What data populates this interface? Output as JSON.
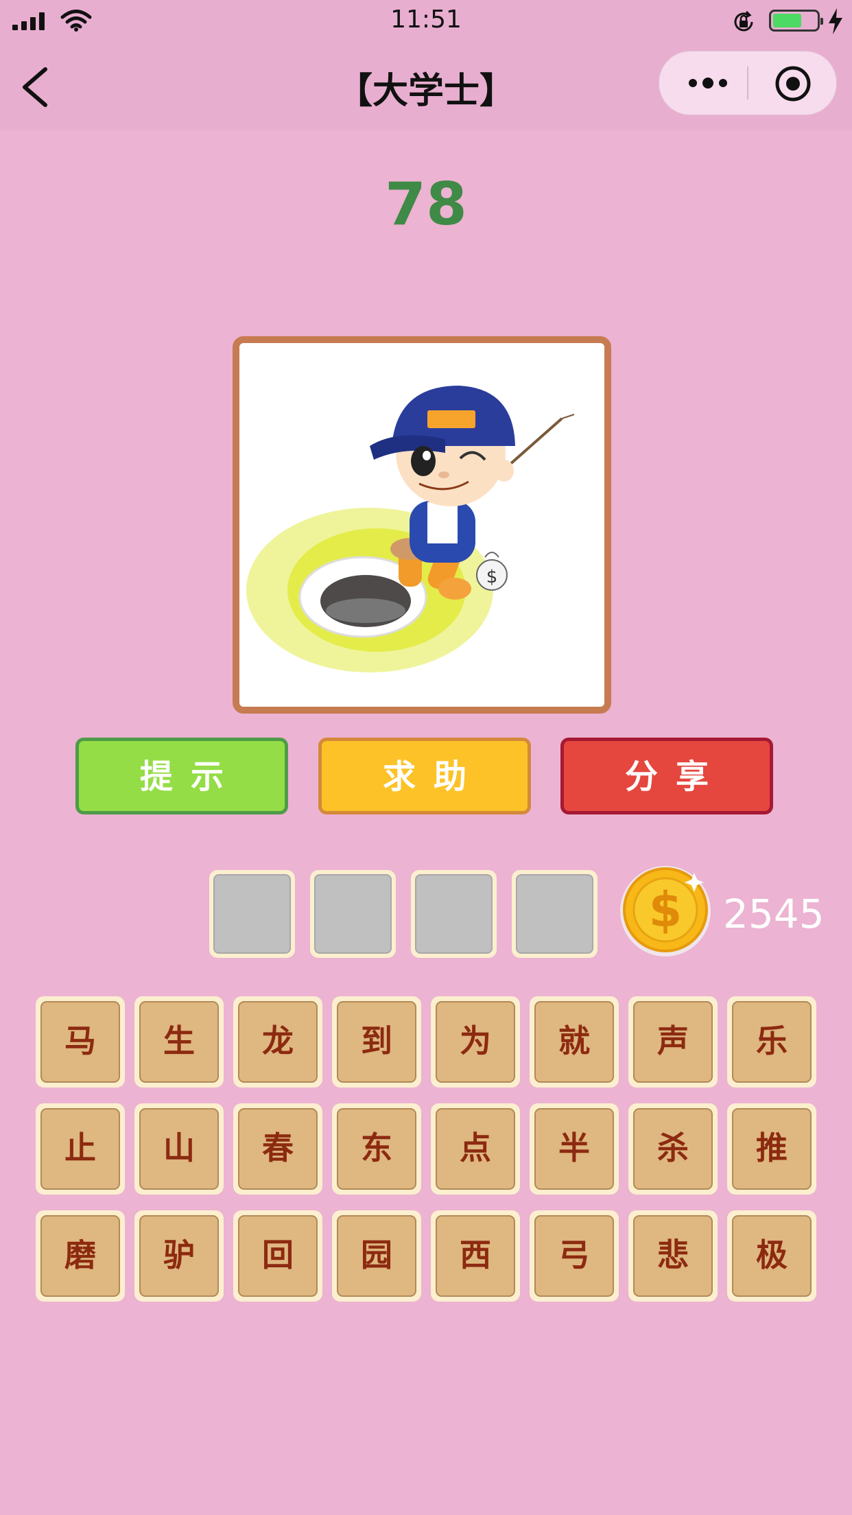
{
  "status_bar": {
    "time": "11:51"
  },
  "nav": {
    "title": "【大学士】"
  },
  "level": "78",
  "buttons": {
    "hint": "提示",
    "help": "求助",
    "share": "分享"
  },
  "answer_slots": [
    "",
    "",
    "",
    ""
  ],
  "coins": "2545",
  "char_tiles": [
    [
      "马",
      "生",
      "龙",
      "到",
      "为",
      "就",
      "声",
      "乐"
    ],
    [
      "止",
      "山",
      "春",
      "东",
      "点",
      "半",
      "杀",
      "推"
    ],
    [
      "磨",
      "驴",
      "回",
      "园",
      "西",
      "弓",
      "悲",
      "极"
    ]
  ],
  "colors": {
    "background": "#ecb3d2",
    "level_number": "#3f8a46",
    "hint_button": "#94dd46",
    "help_button": "#fcc228",
    "share_button": "#e5473e",
    "tile_face": "#dfb780",
    "tile_text": "#8c2a10"
  },
  "icons": [
    "back-chevron-icon",
    "more-dots-icon",
    "target-icon",
    "coin-icon",
    "signal-icon",
    "wifi-icon",
    "rotation-lock-icon",
    "battery-icon",
    "charging-bolt-icon"
  ]
}
